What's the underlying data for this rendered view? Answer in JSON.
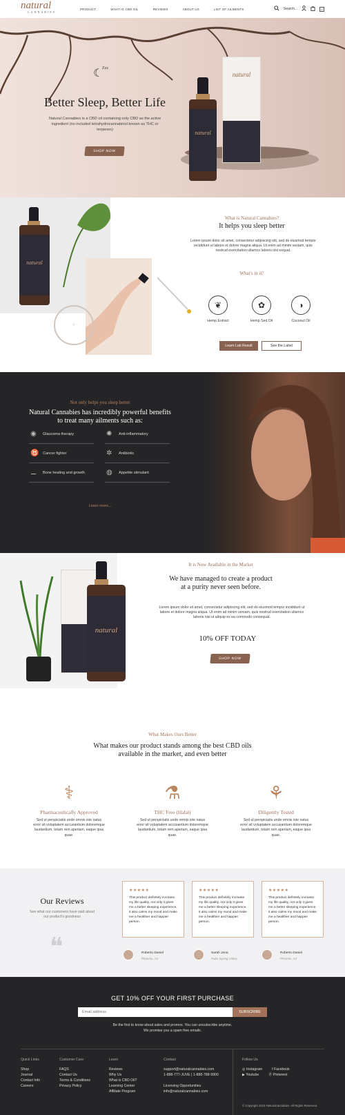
{
  "header": {
    "logo": "natural",
    "logo_sub": "CANNABIES",
    "nav": [
      "PRODUCT",
      "WHAT IS CBD OIL",
      "REVIEWS",
      "ABOUT US",
      "LIST OF AILMENTS"
    ],
    "search_label": "Search...",
    "cart_count": "0"
  },
  "hero": {
    "title": "Better Sleep, Better Life",
    "text": "Natural Cannabies is a CBD oil containing only CBD as the active ingredient (no included tetrahydrocannabinol known as THC or terpenes)",
    "button": "SHOP NOW",
    "sleep_glyph": "Zzz"
  },
  "about": {
    "kicker": "What is Natural Cannabies?",
    "heading": "It helps you sleep better",
    "text": "Lorem ipsum dolor sit amet, consectetur adipiscing elit, sed do eiusmod tempor incididunt ut labore et dolore magna aliqua. Ut enim ad minim veniam, quis nostrud exercitation ullamco laboris nisi exquat.",
    "whats_in": "What's in it?",
    "ingredients": [
      "Hemp Extract",
      "Hemp Sed Oil",
      "Coconut Oil"
    ],
    "btn_lab": "Learn Lab Result",
    "btn_label": "See the Label"
  },
  "benefits": {
    "kicker": "Not only helps you sleep better",
    "heading_line1": "Natural Cannabies has incredibly powerful benefits",
    "heading_line2": "to treat many ailments such as:",
    "items": [
      "Glaucoma therapy",
      "Anti-inflammatory",
      "Cancer fighter",
      "Antibiotic",
      "Bone healing and growth",
      "Appetite stimulant"
    ],
    "learn_more": "Learn more..."
  },
  "market": {
    "kicker": "It is Now Available in the Market",
    "heading_line1": "We have managed to create a product",
    "heading_line2": "at a purity never seen before.",
    "text": "Lorem ipsum dolor sit amet, consectetur adipiscing elit, sed do eiusmod tempor incididunt ut labore et dolore magna aliqua. Ut enim ad minim veniam, quis nostrud exercitation ullamco laboris nisi ut aliquip ex ea commodo consequat.",
    "offer": "10% OFF TODAY",
    "button": "SHOP NOW"
  },
  "better": {
    "kicker": "What Makes Ours Better",
    "heading_line1": "What makes our product stands among the best CBD oils",
    "heading_line2": "available in the market, and even better",
    "features": [
      {
        "title": "Pharmaceutically Approved",
        "text": "Sed ut perspiciatis unde omnis iste natus error sit voluptatem accusantium doloremque laudantium, totam rem aperiam, eaque ipsa quae."
      },
      {
        "title": "THC Free (Halal)",
        "text": "Sed ut perspiciatis unde omnis iste natus error sit voluptatem accusantium doloremque laudantium, totam rem aperiam, eaque ipsa quae."
      },
      {
        "title": "Diligently Tested",
        "text": "Sed ut perspiciatis unde omnis iste natus error sit voluptatem accusantium doloremque laudantium, totam rem aperiam, eaque ipsa quae."
      }
    ]
  },
  "reviews": {
    "title": "Our Reviews",
    "subtitle": "See what our customers have said about our product's goodness",
    "stars": "★★★★★",
    "review_text": "This product definitely increase my life quality, not only it gives me a better sleeping experience, it also calms my mood and make me a healthier and happier person.",
    "items": [
      {
        "name": "Roberto Daniel",
        "location": "Phoenix, AZ"
      },
      {
        "name": "Sarah Jena",
        "location": "Palm Spring Valley"
      },
      {
        "name": "Roberto Daniel",
        "location": "Phoenix, AZ"
      }
    ]
  },
  "footer": {
    "promo": "GET 10% OFF YOUR FIRST PURCHASE",
    "email_placeholder": "Email address",
    "subscribe": "SUBSCRIBE",
    "note_line1": "Be the first to know about sales and promos. You can unsubscribe anytime.",
    "note_line2": "We promise you a spam free emails.",
    "quick_links": {
      "title": "Quick Links",
      "items": [
        "Shop",
        "Journal",
        "Contact Info",
        "Careers"
      ]
    },
    "customer_care": {
      "title": "Customer Care",
      "items": [
        "FAQS",
        "Contact Us",
        "Terms & Conditions",
        "Privacy Policy"
      ]
    },
    "learn": {
      "title": "Learn",
      "items": [
        "Reviews",
        "Why Us",
        "What is CBD Oil?",
        "Learning Center",
        "Affiliate Program"
      ]
    },
    "contact": {
      "title": "Contact",
      "items": [
        "support@naturalcannabies.com",
        "1-888-777-JUVE | 1-888-788-9900",
        "",
        "Licensing Opportunities",
        "info@naturalcannabies.com"
      ]
    },
    "follow": {
      "title": "Follow Us",
      "instagram": "Instagram",
      "facebook": "Facebook",
      "youtube": "Youtube",
      "pinterest": "Pinterest"
    },
    "copyright": "© Copyright 2019 Naturalcannabies. All Rights Reserved."
  }
}
